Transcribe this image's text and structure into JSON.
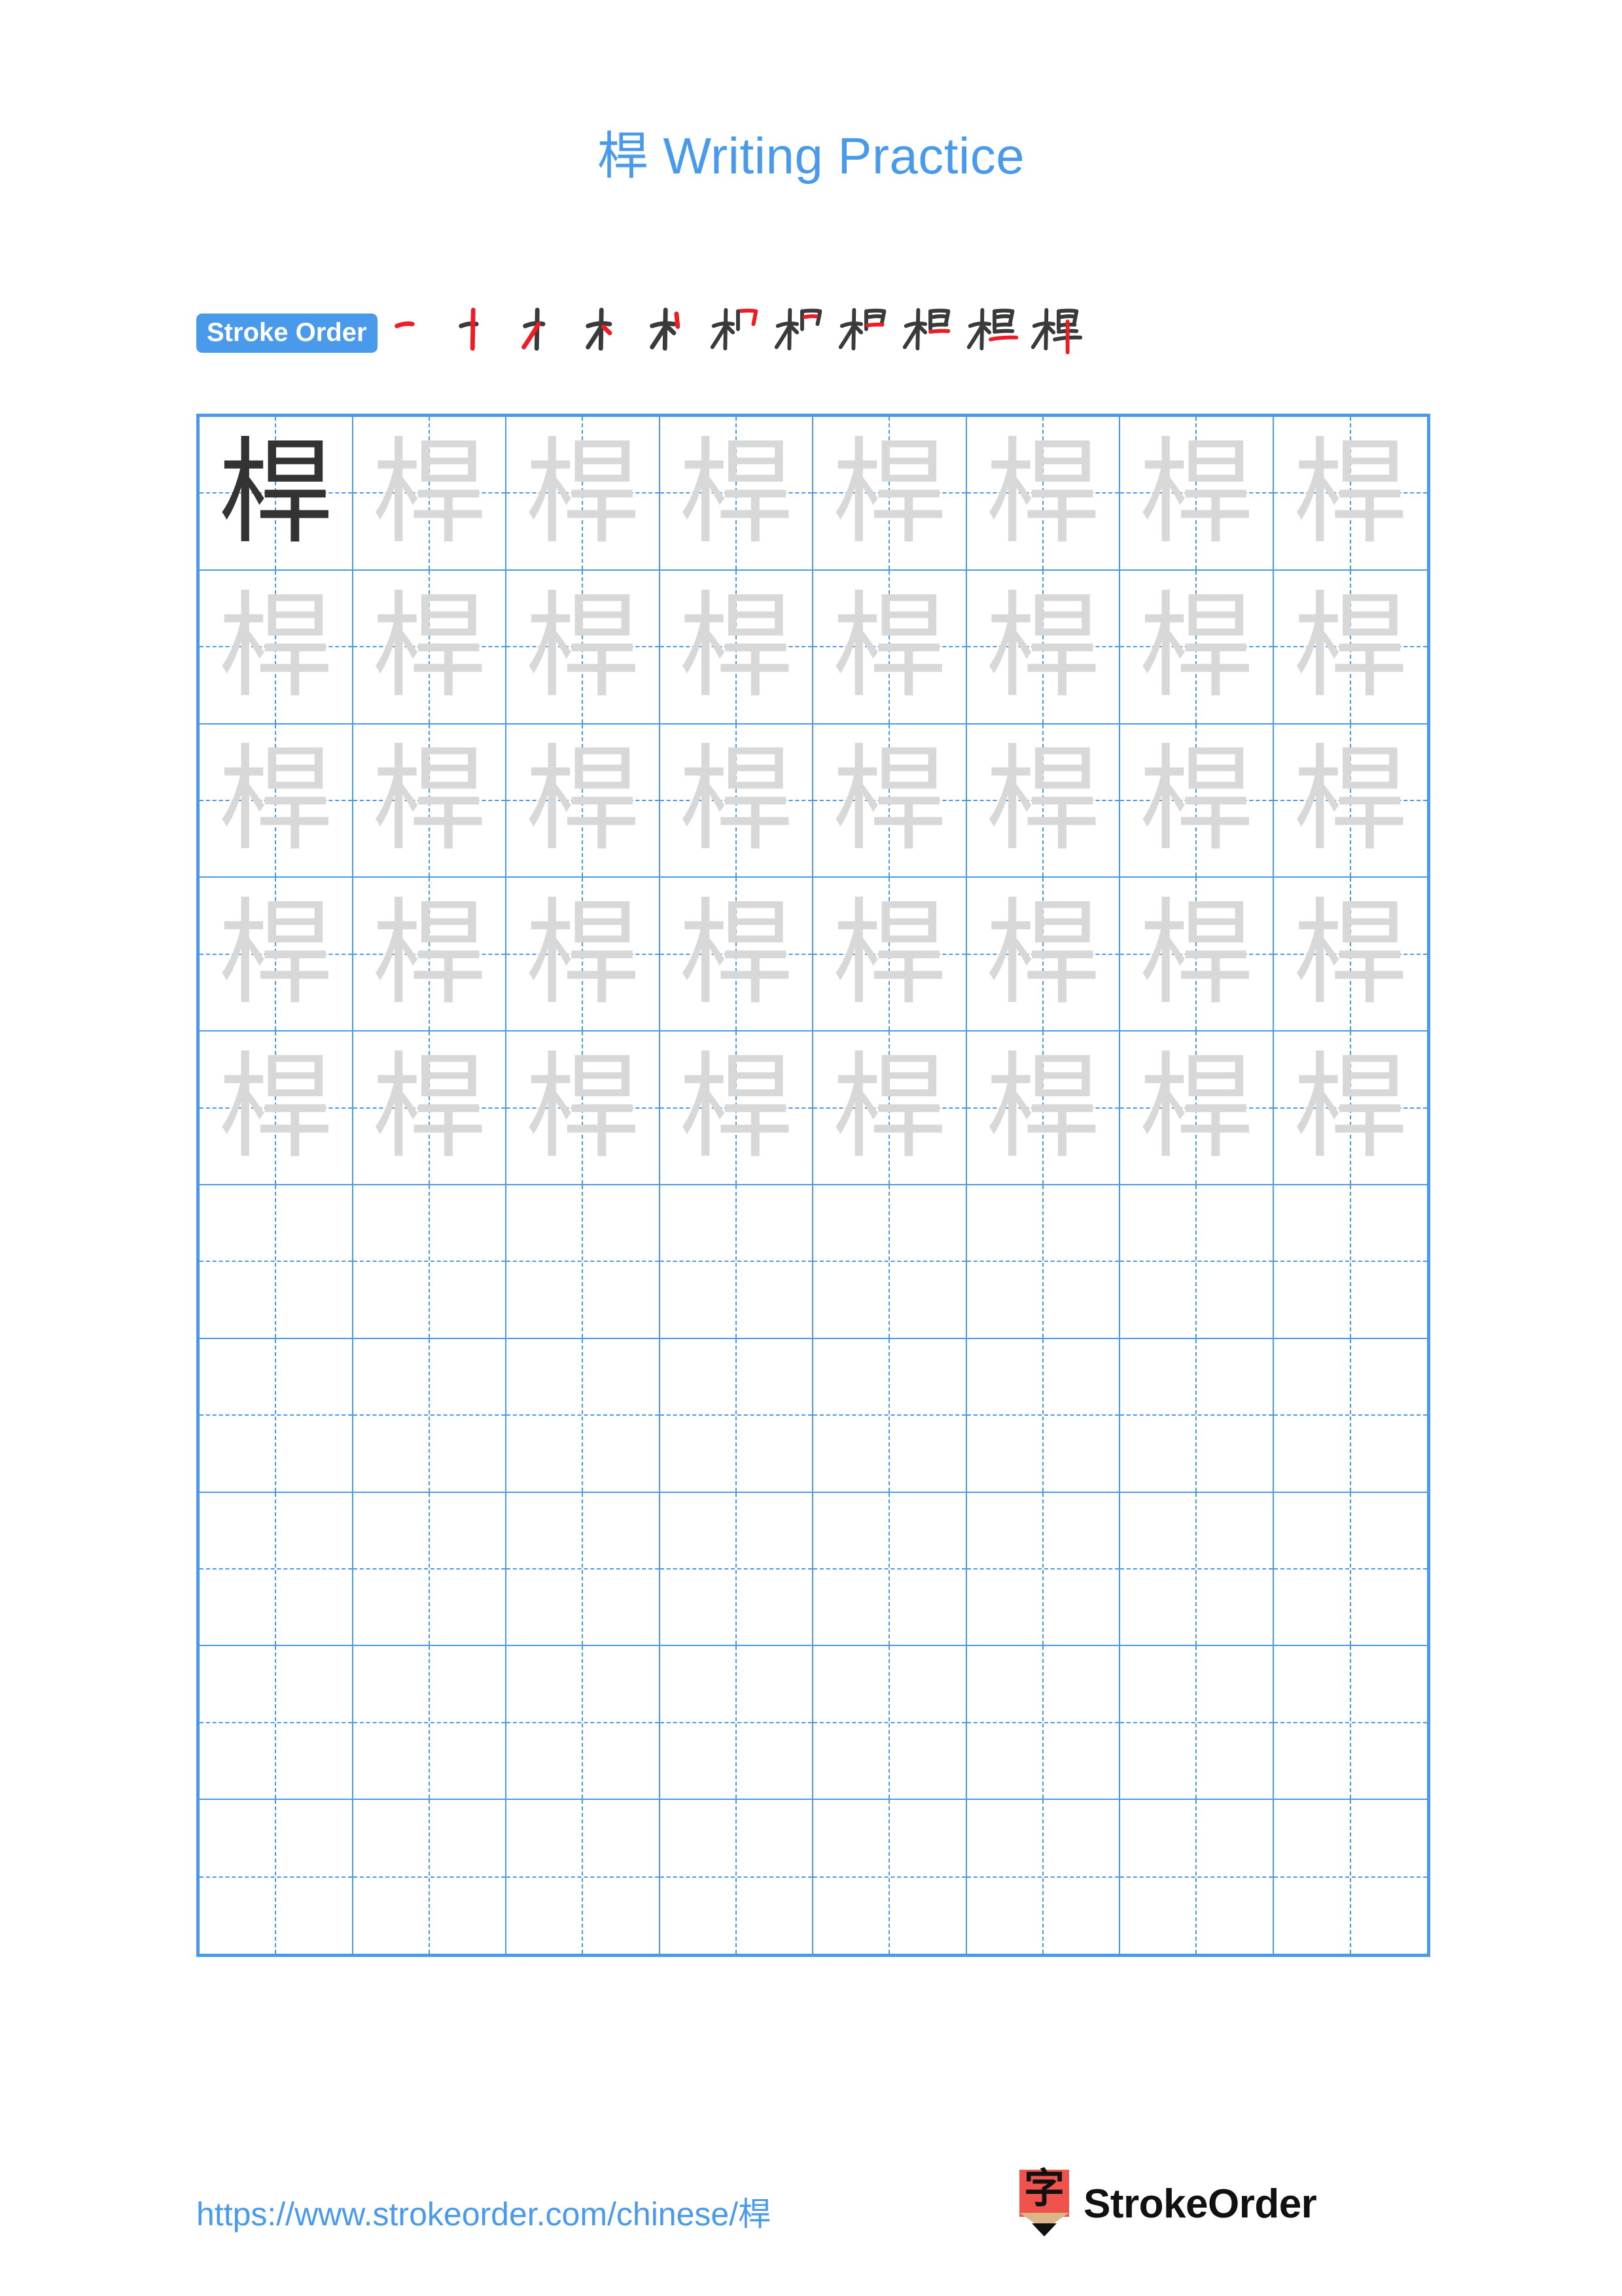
{
  "page": {
    "background": "#ffffff",
    "accent_color": "#4a9aeb",
    "model_char_color": "#333333",
    "trace_char_color": "#d8d8d8",
    "stroke_highlight_color": "#ee1c25",
    "stroke_ink_color": "#3a3a3a"
  },
  "header": {
    "character": "桿",
    "title": "桿 Writing Practice"
  },
  "stroke_order": {
    "badge_label": "Stroke Order",
    "total_strokes": 11,
    "steps": [
      {
        "index": 1,
        "glyph": "一"
      },
      {
        "index": 2,
        "glyph": "十"
      },
      {
        "index": 3,
        "glyph": "才"
      },
      {
        "index": 4,
        "glyph": "木"
      },
      {
        "index": 5,
        "glyph": "术"
      },
      {
        "index": 6,
        "glyph": "杓"
      },
      {
        "index": 7,
        "glyph": "杊"
      },
      {
        "index": 8,
        "glyph": "柜"
      },
      {
        "index": 9,
        "glyph": "桓"
      },
      {
        "index": 10,
        "glyph": "桯"
      },
      {
        "index": 11,
        "glyph": "桿"
      }
    ]
  },
  "practice_grid": {
    "columns": 8,
    "rows": 10,
    "filled_rows": 5,
    "empty_rows": 5,
    "model_cell": {
      "row": 1,
      "col": 1,
      "character": "桿"
    },
    "trace_character": "桿"
  },
  "footer": {
    "url": "https://www.strokeorder.com/chinese/桿",
    "logo_glyph": "字",
    "logo_wordmark": "StrokeOrder"
  }
}
